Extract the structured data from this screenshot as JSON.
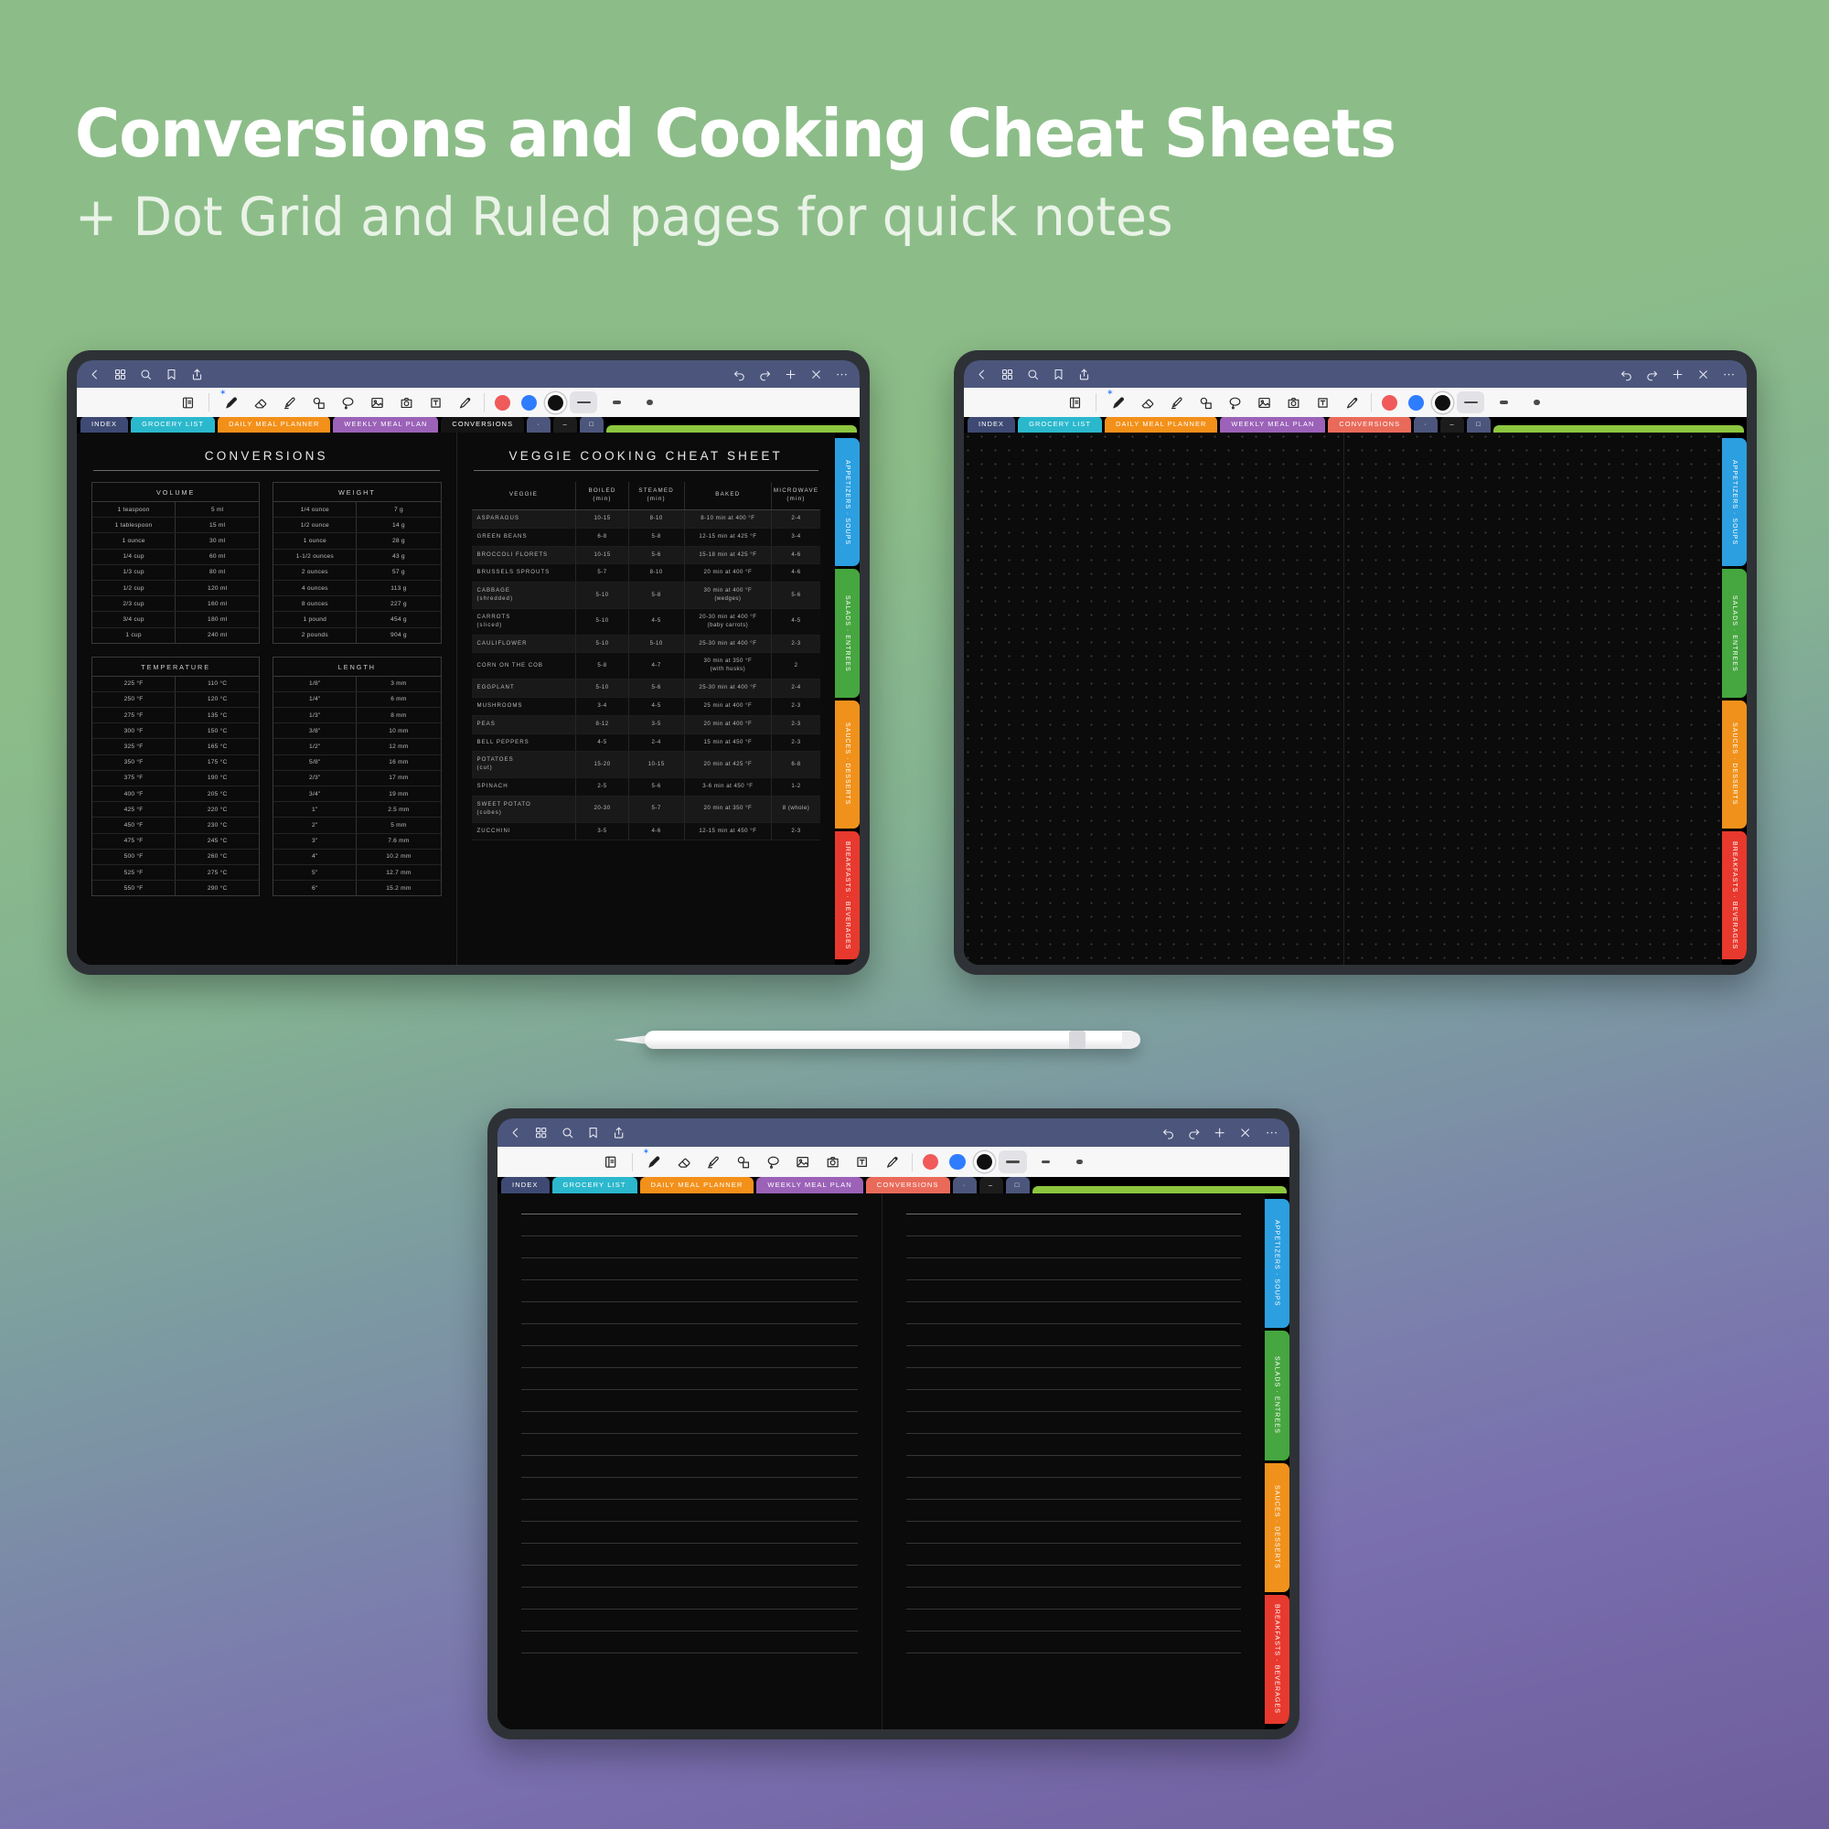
{
  "header": {
    "title": "Conversions and Cooking Cheat Sheets",
    "subtitle": "+ Dot Grid and Ruled pages for quick notes"
  },
  "appbar": {
    "icons_left": [
      "back-chevron-icon",
      "grid-thumbnails-icon",
      "search-icon",
      "bookmark-icon",
      "share-icon"
    ],
    "icons_right": [
      "undo-icon",
      "redo-icon",
      "add-page-icon",
      "close-icon",
      "more-options-icon"
    ],
    "bg_color": "#4c567c"
  },
  "toolbar": {
    "tools": [
      {
        "name": "read-write-toggle-icon",
        "active": false
      },
      {
        "name": "pen-icon",
        "active": true
      },
      {
        "name": "eraser-icon",
        "active": false
      },
      {
        "name": "highlighter-icon",
        "active": false
      },
      {
        "name": "shapes-icon",
        "active": false
      },
      {
        "name": "lasso-select-icon",
        "active": false
      },
      {
        "name": "image-icon",
        "active": false
      },
      {
        "name": "camera-icon",
        "active": false
      },
      {
        "name": "text-box-icon",
        "active": false
      },
      {
        "name": "sticker-icon",
        "active": false
      }
    ],
    "colors": [
      {
        "name": "red-swatch",
        "hex": "#f05a5a",
        "selected": false
      },
      {
        "name": "blue-swatch",
        "hex": "#2f7dff",
        "selected": false
      },
      {
        "name": "black-swatch",
        "hex": "#101010",
        "selected": true
      }
    ],
    "stroke_widths": [
      {
        "name": "width-thin",
        "selected": true
      },
      {
        "name": "width-medium",
        "selected": false
      },
      {
        "name": "width-thick",
        "selected": false
      }
    ]
  },
  "tabs": [
    {
      "label": "INDEX",
      "color": "#3e4a73"
    },
    {
      "label": "GROCERY LIST",
      "color": "#2bb8cd"
    },
    {
      "label": "DAILY MEAL PLANNER",
      "color": "#f39019"
    },
    {
      "label": "WEEKLY MEAL PLAN",
      "color": "#9b62b8"
    },
    {
      "label": "CONVERSIONS",
      "color": "#ea6a5a"
    }
  ],
  "tabs_mini": [
    {
      "label": "·",
      "color": "#4c567c"
    },
    {
      "label": "–",
      "color": "#1c1c1c"
    },
    {
      "label": "□",
      "color": "#4c567c"
    }
  ],
  "tab_last": {
    "label": "",
    "color": "#8cc63f"
  },
  "tab_active_color": "#141414",
  "side_tabs": [
    {
      "label": "APPETIZERS · SOUPS",
      "color": "#2b9fe0"
    },
    {
      "label": "SALADS · ENTREES",
      "color": "#46a63f"
    },
    {
      "label": "SAUCES · DESSERTS",
      "color": "#f0911b"
    },
    {
      "label": "BREAKFASTS · BEVERAGES",
      "color": "#e8392e"
    }
  ],
  "conversions": {
    "page_title": "CONVERSIONS",
    "volume": {
      "header": "VOLUME",
      "rows": [
        [
          "1 teaspoon",
          "5 ml"
        ],
        [
          "1 tablespoon",
          "15 ml"
        ],
        [
          "1 ounce",
          "30 ml"
        ],
        [
          "1/4 cup",
          "60 ml"
        ],
        [
          "1/3 cup",
          "80 ml"
        ],
        [
          "1/2 cup",
          "120 ml"
        ],
        [
          "2/3 cup",
          "160 ml"
        ],
        [
          "3/4 cup",
          "180 ml"
        ],
        [
          "1 cup",
          "240 ml"
        ]
      ]
    },
    "weight": {
      "header": "WEIGHT",
      "rows": [
        [
          "1/4 ounce",
          "7 g"
        ],
        [
          "1/2 ounce",
          "14 g"
        ],
        [
          "1 ounce",
          "28 g"
        ],
        [
          "1-1/2 ounces",
          "43 g"
        ],
        [
          "2 ounces",
          "57 g"
        ],
        [
          "4 ounces",
          "113 g"
        ],
        [
          "8 ounces",
          "227 g"
        ],
        [
          "1 pound",
          "454 g"
        ],
        [
          "2 pounds",
          "904 g"
        ]
      ]
    },
    "temperature": {
      "header": "TEMPERATURE",
      "rows": [
        [
          "225 °F",
          "110 °C"
        ],
        [
          "250 °F",
          "120 °C"
        ],
        [
          "275 °F",
          "135 °C"
        ],
        [
          "300 °F",
          "150 °C"
        ],
        [
          "325 °F",
          "165 °C"
        ],
        [
          "350 °F",
          "175 °C"
        ],
        [
          "375 °F",
          "190 °C"
        ],
        [
          "400 °F",
          "205 °C"
        ],
        [
          "425 °F",
          "220 °C"
        ],
        [
          "450 °F",
          "230 °C"
        ],
        [
          "475 °F",
          "245 °C"
        ],
        [
          "500 °F",
          "260 °C"
        ],
        [
          "525 °F",
          "275 °C"
        ],
        [
          "550 °F",
          "290 °C"
        ]
      ]
    },
    "length": {
      "header": "LENGTH",
      "rows": [
        [
          "1/8\"",
          "3 mm"
        ],
        [
          "1/4\"",
          "6 mm"
        ],
        [
          "1/3\"",
          "8 mm"
        ],
        [
          "3/8\"",
          "10 mm"
        ],
        [
          "1/2\"",
          "12 mm"
        ],
        [
          "5/8\"",
          "16 mm"
        ],
        [
          "2/3\"",
          "17 mm"
        ],
        [
          "3/4\"",
          "19 mm"
        ],
        [
          "1\"",
          "2.5 mm"
        ],
        [
          "2\"",
          "5 mm"
        ],
        [
          "3\"",
          "7.6 mm"
        ],
        [
          "4\"",
          "10.2 mm"
        ],
        [
          "5\"",
          "12.7 mm"
        ],
        [
          "6\"",
          "15.2 mm"
        ]
      ]
    }
  },
  "veggie_sheet": {
    "page_title": "VEGGIE COOKING CHEAT SHEET",
    "columns": [
      "VEGGIE",
      "BOILED\n(min)",
      "STEAMED\n(min)",
      "BAKED",
      "MICROWAVE\n(min)"
    ],
    "columns_main": [
      "VEGGIE",
      "BOILED",
      "STEAMED",
      "BAKED",
      "MICROWAVE"
    ],
    "columns_sub": [
      "",
      "(min)",
      "(min)",
      "",
      "(min)"
    ],
    "rows": [
      [
        "ASPARAGUS",
        "10-15",
        "8-10",
        "8-10 min at 400 °F",
        "2-4"
      ],
      [
        "GREEN BEANS",
        "6-8",
        "5-8",
        "12-15 min at 425 °F",
        "3-4"
      ],
      [
        "BROCCOLI FLORETS",
        "10-15",
        "5-6",
        "15-18 min at 425 °F",
        "4-6"
      ],
      [
        "BRUSSELS SPROUTS",
        "5-7",
        "8-10",
        "20 min at 400 °F",
        "4-6"
      ],
      [
        "CABBAGE (shredded)",
        "5-10",
        "5-8",
        "30 min at 400 °F (wedges)",
        "5-6"
      ],
      [
        "CARROTS (sliced)",
        "5-10",
        "4-5",
        "20-30 min at 400 °F (baby carrots)",
        "4-5"
      ],
      [
        "CAULIFLOWER",
        "5-10",
        "5-10",
        "25-30 min at 400 °F",
        "2-3"
      ],
      [
        "CORN ON THE COB",
        "5-8",
        "4-7",
        "30 min at 350 °F (with husks)",
        "2"
      ],
      [
        "EGGPLANT",
        "5-10",
        "5-6",
        "25-30 min at 400 °F",
        "2-4"
      ],
      [
        "MUSHROOMS",
        "3-4",
        "4-5",
        "25 min at 400 °F",
        "2-3"
      ],
      [
        "PEAS",
        "8-12",
        "3-5",
        "20 min at 400 °F",
        "2-3"
      ],
      [
        "BELL PEPPERS",
        "4-5",
        "2-4",
        "15 min at 450 °F",
        "2-3"
      ],
      [
        "POTATOES (cut)",
        "15-20",
        "10-15",
        "20 min at 425 °F",
        "6-8"
      ],
      [
        "SPINACH",
        "2-5",
        "5-6",
        "3-6 min at 450 °F",
        "1-2"
      ],
      [
        "SWEET POTATO (cubes)",
        "20-30",
        "5-7",
        "20 min at 350 °F",
        "8 (whole)"
      ],
      [
        "ZUCCHINI",
        "3-5",
        "4-6",
        "12-15 min at 450 °F",
        "2-3"
      ]
    ]
  },
  "devices": {
    "left": {
      "name": "tablet-conversions",
      "page_type": "cheat-sheet"
    },
    "right": {
      "name": "tablet-dot-grid",
      "page_type": "dot-grid"
    },
    "bottom": {
      "name": "tablet-ruled",
      "page_type": "ruled"
    }
  },
  "stylus": {
    "name": "stylus-pen"
  }
}
